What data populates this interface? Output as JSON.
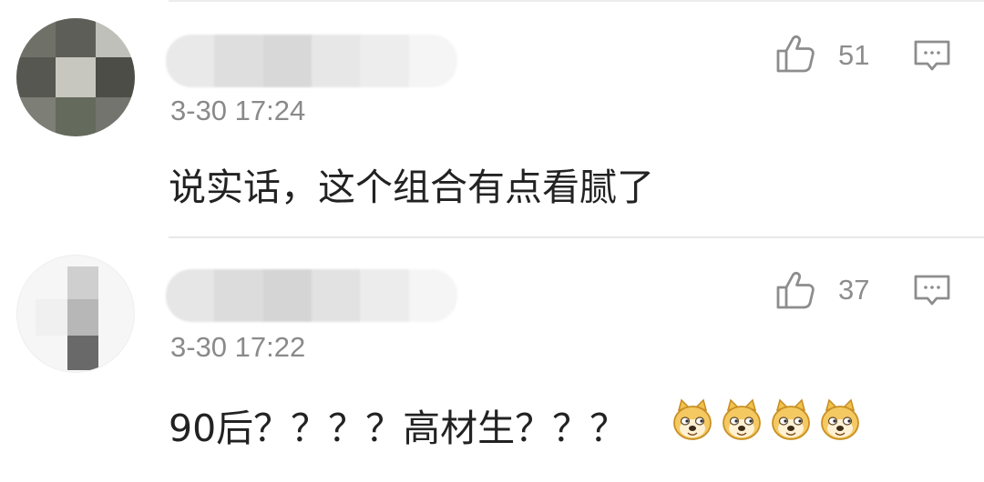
{
  "comments": [
    {
      "username": "",
      "timestamp": "3-30 17:24",
      "text": "说实话，这个组合有点看腻了",
      "likes": "51"
    },
    {
      "username": "",
      "timestamp": "3-30 17:22",
      "text": "90后？？？？高材生？？？",
      "likes": "37",
      "emojis": [
        "doge",
        "doge",
        "doge",
        "doge"
      ]
    }
  ],
  "icons": {
    "like": "thumbs-up-icon",
    "reply": "comment-bubble-icon",
    "emoji": "doge-emoji-icon"
  },
  "colors": {
    "text_primary": "#222222",
    "text_secondary": "#8a8a8a",
    "divider": "#e8e8e8",
    "icon_gray": "#8d8d8d"
  }
}
